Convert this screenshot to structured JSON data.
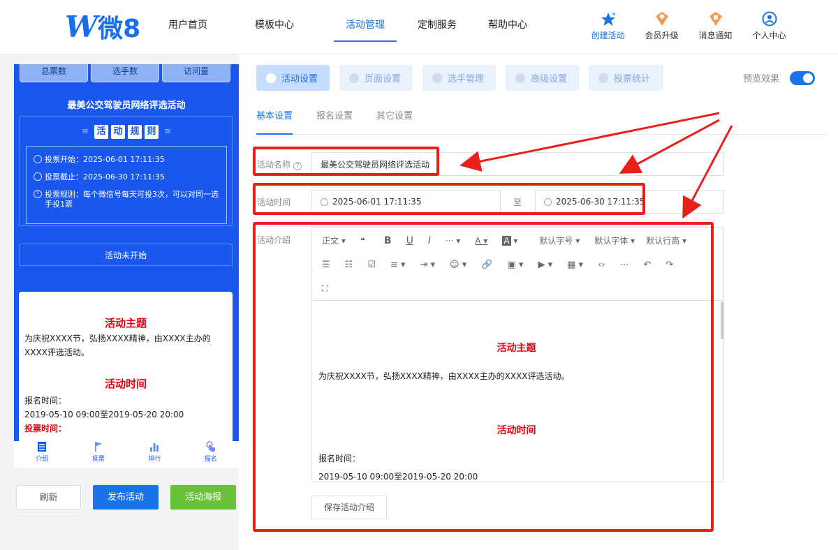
{
  "logo": {
    "text": "微8"
  },
  "nav": {
    "items": [
      "用户首页",
      "模板中心",
      "活动管理",
      "定制服务",
      "帮助中心"
    ],
    "active_index": 2
  },
  "top_icons": [
    {
      "label": "创建活动",
      "icon": "star-icon"
    },
    {
      "label": "会员升级",
      "icon": "crown-badge-icon"
    },
    {
      "label": "消息通知",
      "icon": "bell-badge-icon"
    },
    {
      "label": "个人中心",
      "icon": "user-icon"
    }
  ],
  "phone": {
    "stats": [
      "总票数",
      "选手数",
      "访问量"
    ],
    "title": "最美公交驾驶员网络评选活动",
    "rules_title": [
      "活",
      "动",
      "规",
      "则"
    ],
    "rules": {
      "start": "投票开始：2025-06-01 17:11:35",
      "end": "投票截止：2025-06-30 17:11:35",
      "rule": "投票规则：每个微信号每天可投3次，可以对同一选手投1票"
    },
    "status": "活动未开始",
    "card": {
      "heading1": "活动主题",
      "text1": "为庆祝XXXX节，弘扬XXXX精神，由XXXX主办的XXXX评选活动。",
      "heading2": "活动时间",
      "line1": "报名时间：",
      "line2": "2019-05-10 09:00至2019-05-20 20:00",
      "line3": "投票时间："
    },
    "tabbar": [
      "介绍",
      "投票",
      "排行",
      "报名"
    ]
  },
  "buttons": {
    "refresh": "刷新",
    "publish": "发布活动",
    "poster": "活动海报"
  },
  "colors": {
    "primary": "#1a73e8",
    "phone_bg": "#1a57ee",
    "accent_red": "#e60012",
    "annotation": "#e8201a",
    "green": "#67c23a"
  },
  "top_tabs": [
    "活动设置",
    "页面设置",
    "选手管理",
    "高级设置",
    "投票统计"
  ],
  "preview_label": "预览效果",
  "sub_tabs": [
    "基本设置",
    "报名设置",
    "其它设置"
  ],
  "form": {
    "name_label": "活动名称",
    "name_value": "最美公交驾驶员网络评选活动",
    "time_label": "活动时间",
    "start_time": "2025-06-01 17:11:35",
    "to_label": "至",
    "end_time": "2025-06-30 17:11:35",
    "intro_label": "活动介绍"
  },
  "editor": {
    "toolbar_row1": [
      "正文",
      "❝",
      "B",
      "U",
      "I",
      "···",
      "A",
      "A",
      "默认字号",
      "默认字体",
      "默认行高"
    ],
    "content": {
      "heading1": "活动主题",
      "text1": "为庆祝XXXX节，弘扬XXXX精神，由XXXX主办的XXXX评选活动。",
      "heading2": "活动时间",
      "line1": "报名时间：",
      "line2": "2019-05-10 09:00至2019-05-20 20:00"
    }
  },
  "save_intro": "保存活动介绍"
}
